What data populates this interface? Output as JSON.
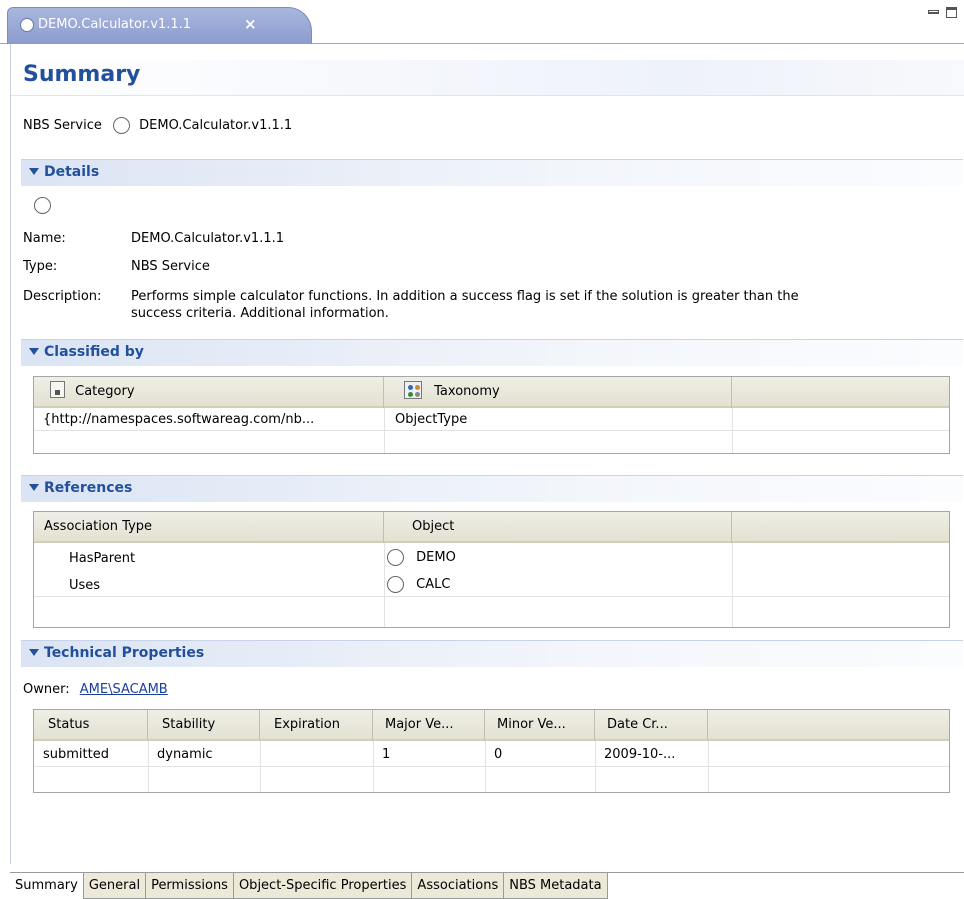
{
  "editor_tab": {
    "title": "DEMO.Calculator.v1.1.1",
    "close_glyph": "×",
    "icon": "service-circle-icon"
  },
  "window_controls": {
    "minimize_icon": "minimize-icon",
    "maximize_icon": "maximize-icon"
  },
  "form": {
    "title": "Summary"
  },
  "service_line": {
    "type_label": "NBS Service",
    "name": "DEMO.Calculator.v1.1.1"
  },
  "details": {
    "section_title": "Details",
    "name_label": "Name:",
    "name_value": "DEMO.Calculator.v1.1.1",
    "type_label": "Type:",
    "type_value": "NBS Service",
    "description_label": "Description:",
    "description_line1": "Performs simple calculator functions. In addition a success flag is set if the solution is greater than the",
    "description_line2": "success criteria. Additional information."
  },
  "classified_by": {
    "section_title": "Classified by",
    "columns": [
      "Category",
      "Taxonomy"
    ],
    "rows": [
      {
        "category": "{http://namespaces.softwareag.com/nb...",
        "taxonomy": "ObjectType"
      }
    ]
  },
  "references": {
    "section_title": "References",
    "columns": [
      "Association Type",
      "Object"
    ],
    "rows": [
      {
        "association_type": "HasParent",
        "object": "DEMO"
      },
      {
        "association_type": "Uses",
        "object": "CALC"
      }
    ]
  },
  "technical_properties": {
    "section_title": "Technical Properties",
    "owner_label": "Owner:",
    "owner_value": "AME\\SACAMB",
    "columns": [
      "Status",
      "Stability",
      "Expiration",
      "Major Ve...",
      "Minor Ve...",
      "Date Cr..."
    ],
    "rows": [
      {
        "status": "submitted",
        "stability": "dynamic",
        "expiration": "",
        "major": "1",
        "minor": "0",
        "date": "2009-10-..."
      }
    ]
  },
  "page_tabs": [
    "Summary",
    "General",
    "Permissions",
    "Object-Specific Properties",
    "Associations",
    "NBS Metadata"
  ]
}
